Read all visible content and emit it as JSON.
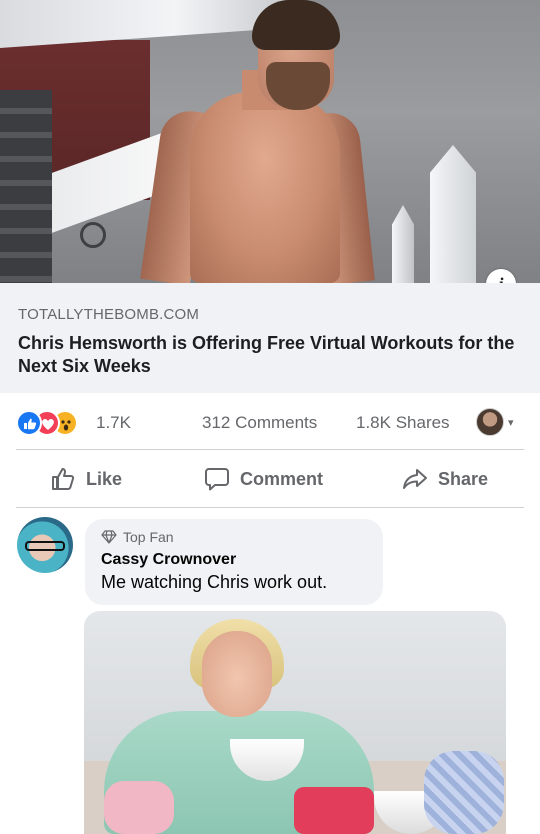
{
  "link_preview": {
    "domain": "TOTALLYTHEBOMB.COM",
    "headline": "Chris Hemsworth is Offering Free Virtual Workouts for the Next Six Weeks",
    "info_icon_glyph": "i"
  },
  "reactions": {
    "icons": [
      "like-icon",
      "love-icon",
      "wow-icon"
    ],
    "count": "1.7K",
    "comments": "312 Comments",
    "shares": "1.8K Shares",
    "audience_caret": "▾"
  },
  "actions": {
    "like": "Like",
    "comment": "Comment",
    "share": "Share"
  },
  "comment": {
    "badge": "Top Fan",
    "author": "Cassy Crownover",
    "text": "Me watching Chris work out."
  },
  "colors": {
    "like_blue": "#1877f2",
    "love_red": "#f33e58",
    "wow_yellow": "#f7b125",
    "muted_text": "#65676b",
    "caption_bg": "#f0f2f5"
  }
}
